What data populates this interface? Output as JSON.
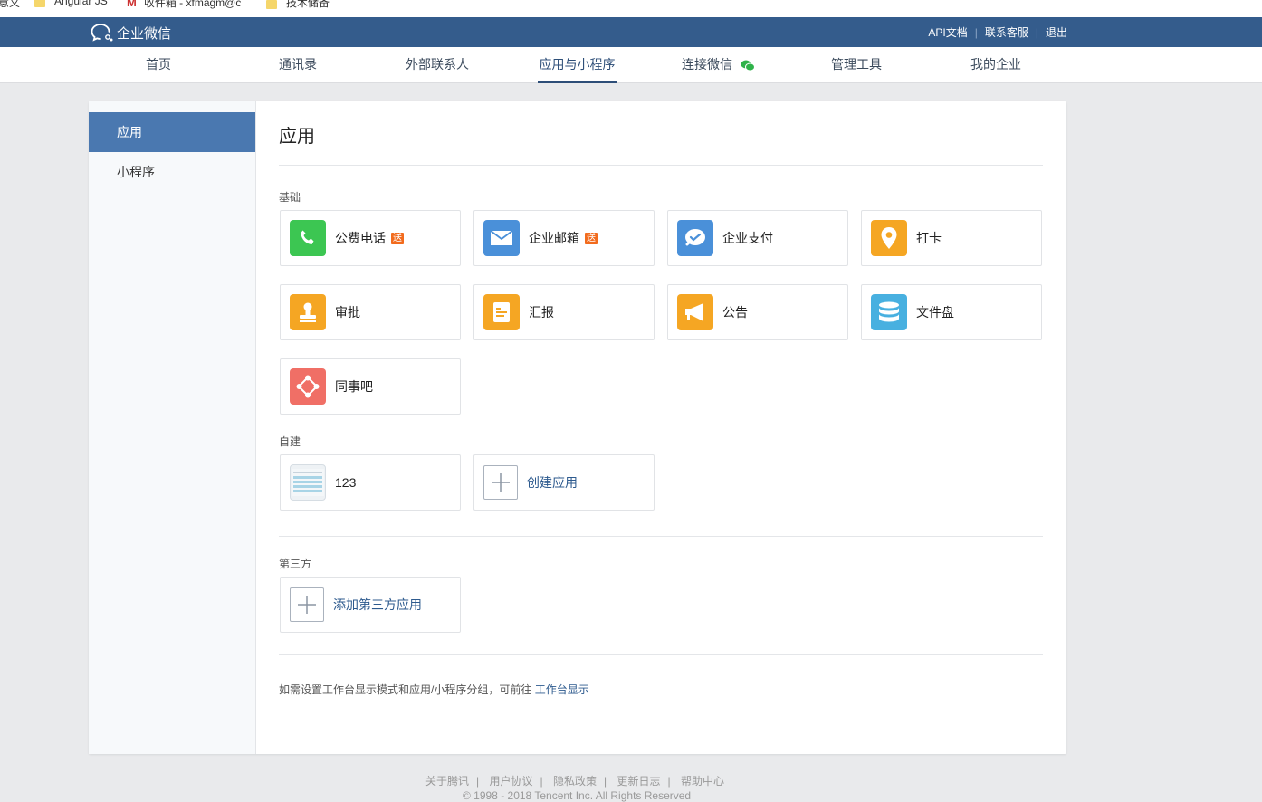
{
  "bookmarks": [
    {
      "label": "意义"
    },
    {
      "label": "Angular JS"
    },
    {
      "label": "收件箱 - xfmagm@c"
    },
    {
      "label": "技术储备"
    }
  ],
  "brand": {
    "name": "企业微信"
  },
  "top_links": {
    "api": "API文档",
    "support": "联系客服",
    "logout": "退出"
  },
  "nav": [
    {
      "label": "首页"
    },
    {
      "label": "通讯录"
    },
    {
      "label": "外部联系人"
    },
    {
      "label": "应用与小程序"
    },
    {
      "label": "连接微信"
    },
    {
      "label": "管理工具"
    },
    {
      "label": "我的企业"
    }
  ],
  "sidebar": [
    {
      "label": "应用"
    },
    {
      "label": "小程序"
    }
  ],
  "page_title": "应用",
  "sections": {
    "basic": "基础",
    "custom": "自建",
    "third": "第三方"
  },
  "basic_apps": [
    {
      "name": "公费电话",
      "tag": "送",
      "icon": "phone-icon",
      "color": "#3cc652"
    },
    {
      "name": "企业邮箱",
      "tag": "送",
      "icon": "mail-icon",
      "color": "#4a90d9"
    },
    {
      "name": "企业支付",
      "tag": "",
      "icon": "payment-icon",
      "color": "#4a90d9"
    },
    {
      "name": "打卡",
      "tag": "",
      "icon": "location-pin-icon",
      "color": "#f5a623"
    },
    {
      "name": "审批",
      "tag": "",
      "icon": "stamp-icon",
      "color": "#f5a623"
    },
    {
      "name": "汇报",
      "tag": "",
      "icon": "report-icon",
      "color": "#f5a623"
    },
    {
      "name": "公告",
      "tag": "",
      "icon": "megaphone-icon",
      "color": "#f5a623"
    },
    {
      "name": "文件盘",
      "tag": "",
      "icon": "database-icon",
      "color": "#48b0e0"
    },
    {
      "name": "同事吧",
      "tag": "",
      "icon": "network-icon",
      "color": "#f06f66"
    }
  ],
  "custom_apps": [
    {
      "name": "123",
      "icon": "spreadsheet-thumbnail-icon"
    }
  ],
  "create_app": "创建应用",
  "add_third_party": "添加第三方应用",
  "tip": {
    "text": "如需设置工作台显示模式和应用/小程序分组，可前往",
    "link": "工作台显示"
  },
  "footer": {
    "links": [
      "关于腾讯",
      "用户协议",
      "隐私政策",
      "更新日志",
      "帮助中心"
    ],
    "copyright": "© 1998 - 2018 Tencent Inc. All Rights Reserved"
  }
}
